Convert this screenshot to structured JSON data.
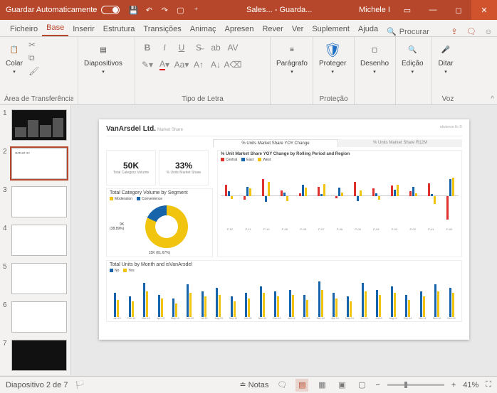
{
  "titlebar": {
    "autosave_label": "Guardar Automaticamente",
    "doc_title": "Sales... - Guarda...",
    "user": "Michele I"
  },
  "tabs": [
    "Ficheiro",
    "Base",
    "Inserir",
    "Estrutura",
    "Transições",
    "Animaç",
    "Apresen",
    "Rever",
    "Ver",
    "Suplement",
    "Ajuda"
  ],
  "active_tab": 1,
  "search_label": "Procurar",
  "ribbon": {
    "clipboard": {
      "paste": "Colar",
      "group": "Área de Transferência"
    },
    "slides": {
      "btn": "Diapositivos",
      "group": ""
    },
    "font": {
      "group": "Tipo de Letra"
    },
    "paragraph": {
      "btn": "Parágrafo"
    },
    "protect": {
      "btn": "Proteger",
      "group": "Proteção"
    },
    "drawing": {
      "btn": "Desenho"
    },
    "editing": {
      "btn": "Edição"
    },
    "voice": {
      "btn": "Ditar",
      "group": "Voz"
    }
  },
  "thumbnails": [
    1,
    2,
    3,
    4,
    5,
    6,
    7
  ],
  "active_thumb": 2,
  "statusbar": {
    "slide": "Diapositivo 2 de 7",
    "lang_flag": "🏳️",
    "notes": "Notas",
    "comments": "🗨",
    "zoom": "41%"
  },
  "slide": {
    "company": "VanArsdel Ltd.",
    "subtitle": "Market Share",
    "footer": "obvience llc ©",
    "kpi1": {
      "val": "50K",
      "lbl": "Total Category Volume"
    },
    "kpi2": {
      "val": "33%",
      "lbl": "% Units Market Share"
    },
    "tab_a": "% Units Market Share YOY Change",
    "tab_b": "% Units Market Share R12M",
    "chart1_title": "% Unit Market Share YOY Change by Rolling Period and Region",
    "legend1": [
      "Central",
      "East",
      "West"
    ],
    "donut_title": "Total Category Volume by Segment",
    "donut_legend": [
      "Moderation",
      "Convenience"
    ],
    "donut_labels": {
      "a": "9K",
      "b": "(38.89%)",
      "c": "15K (61.67%)"
    },
    "chart2_title": "Total Units by Month and isVanArsdel",
    "legend2": [
      "No",
      "Yes"
    ]
  },
  "chart_data": [
    {
      "type": "bar",
      "title": "% Unit Market Share YOY Change by Rolling Period and Region",
      "categories": [
        "P-12",
        "P-11",
        "P-10",
        "P-09",
        "P-08",
        "P-07",
        "P-06",
        "P-05",
        "P-04",
        "P-03",
        "P-02",
        "P-01",
        "P-00"
      ],
      "series": [
        {
          "name": "Central",
          "values": [
            1.2,
            -0.4,
            1.8,
            0.6,
            0.3,
            1.0,
            -0.2,
            1.5,
            0.8,
            1.1,
            0.5,
            1.4,
            -2.5
          ]
        },
        {
          "name": "East",
          "values": [
            0.5,
            1.0,
            -0.6,
            0.4,
            1.2,
            0.2,
            0.9,
            -0.5,
            0.3,
            0.7,
            1.0,
            0.2,
            1.8
          ]
        },
        {
          "name": "West",
          "values": [
            -0.3,
            0.8,
            1.5,
            -0.5,
            0.9,
            1.3,
            0.4,
            0.6,
            -0.4,
            1.2,
            0.3,
            -0.8,
            2.0
          ]
        }
      ],
      "ylim": [
        -3,
        3
      ]
    },
    {
      "type": "pie",
      "title": "Total Category Volume by Segment",
      "categories": [
        "Moderation",
        "Convenience"
      ],
      "values": [
        61.67,
        38.33
      ]
    },
    {
      "type": "bar",
      "title": "Total Units by Month and isVanArsdel",
      "categories": [
        "Jan-13",
        "Feb-13",
        "Mar-13",
        "Apr-13",
        "May-13",
        "Jun-13",
        "Jul-13",
        "Aug-13",
        "Sep-13",
        "Oct-13",
        "Nov-13",
        "Dec-13",
        "Jan-14",
        "Feb-14",
        "Mar-14",
        "Apr-14",
        "May-14",
        "Jun-14",
        "Jul-14",
        "Aug-14",
        "Sep-14",
        "Oct-14",
        "Nov-14",
        "Dec-14"
      ],
      "series": [
        {
          "name": "No",
          "values": [
            28,
            24,
            40,
            26,
            22,
            38,
            30,
            34,
            24,
            28,
            36,
            30,
            32,
            26,
            42,
            28,
            24,
            40,
            32,
            36,
            26,
            30,
            38,
            34
          ]
        },
        {
          "name": "Yes",
          "values": [
            20,
            18,
            30,
            22,
            16,
            28,
            24,
            26,
            18,
            22,
            28,
            24,
            26,
            20,
            32,
            22,
            18,
            30,
            26,
            28,
            20,
            24,
            30,
            28
          ]
        }
      ],
      "ylim": [
        0,
        50
      ]
    }
  ]
}
